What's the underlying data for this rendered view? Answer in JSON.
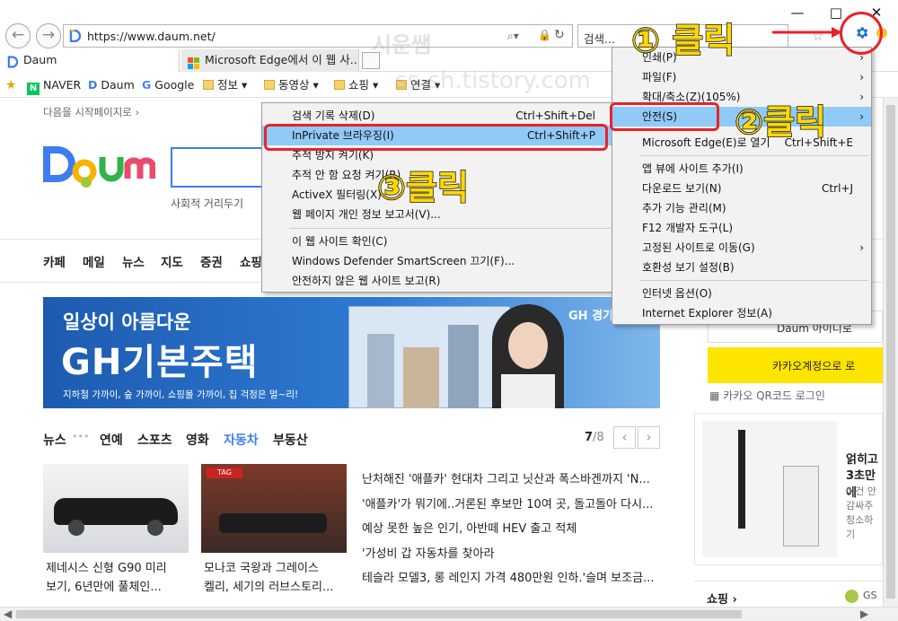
{
  "browser": {
    "url": "https://www.daum.net/",
    "search_placeholder": "검색...",
    "window_min": "—",
    "window_max": "□",
    "window_close": "✕",
    "tabs": [
      "Daum",
      "Microsoft Edge에서 이 웹 사..."
    ],
    "favorites": [
      "NAVER",
      "Daum",
      "Google",
      "정보 ▾",
      "동영상 ▾",
      "쇼핑 ▾",
      "연결 ▾"
    ]
  },
  "watermark": {
    "line1": "시운쌤",
    "line2": "ss-sh.tistory.com"
  },
  "tools_menu": {
    "items": [
      {
        "label": "인쇄(P)",
        "shortcut": "",
        "arrow": "›"
      },
      {
        "label": "파일(F)",
        "shortcut": "",
        "arrow": "›"
      },
      {
        "label": "확대/축소(Z)(105%)",
        "shortcut": "",
        "arrow": "›"
      },
      {
        "label": "안전(S)",
        "shortcut": "",
        "arrow": "›"
      },
      {
        "label": "Microsoft Edge(E)로 열기",
        "shortcut": "Ctrl+Shift+E",
        "arrow": ""
      },
      {
        "label": "앱 뷰에 사이트 추가(I)",
        "shortcut": "",
        "arrow": ""
      },
      {
        "label": "다운로드 보기(N)",
        "shortcut": "Ctrl+J",
        "arrow": ""
      },
      {
        "label": "추가 기능 관리(M)",
        "shortcut": "",
        "arrow": ""
      },
      {
        "label": "F12 개발자 도구(L)",
        "shortcut": "",
        "arrow": ""
      },
      {
        "label": "고정된 사이트로 이동(G)",
        "shortcut": "",
        "arrow": ""
      },
      {
        "label": "호환성 보기 설정(B)",
        "shortcut": "",
        "arrow": ""
      },
      {
        "label": "인터넷 옵션(O)",
        "shortcut": "",
        "arrow": ""
      },
      {
        "label": "Internet Explorer 정보(A)",
        "shortcut": "",
        "arrow": ""
      }
    ]
  },
  "safety_menu": {
    "items": [
      {
        "label": "검색 기록 삭제(D)",
        "shortcut": "Ctrl+Shift+Del"
      },
      {
        "label": "InPrivate 브라우징(I)",
        "shortcut": "Ctrl+Shift+P"
      },
      {
        "label": "추적 방지 켜기(K)",
        "shortcut": ""
      },
      {
        "label": "추적 안 함 요청 켜기(R)",
        "shortcut": ""
      },
      {
        "label": "ActiveX 필터링(X)",
        "shortcut": ""
      },
      {
        "label": "웹 페이지 개인 정보 보고서(V)...",
        "shortcut": ""
      },
      {
        "label": "이 웹 사이트 확인(C)",
        "shortcut": ""
      },
      {
        "label": "Windows Defender SmartScreen 끄기(F)...",
        "shortcut": ""
      },
      {
        "label": "안전하지 않은 웹 사이트 보고(R)",
        "shortcut": ""
      }
    ]
  },
  "annotations": {
    "step1": "① 클릭",
    "step2": "②클릭",
    "step3": "③클릭"
  },
  "daum": {
    "set_start": "다음을 시작페이지로 ›",
    "logo": "Daum",
    "social_distance": "사회적 거리두기",
    "nav": [
      "카페",
      "메일",
      "뉴스",
      "지도",
      "증권",
      "쇼핑"
    ],
    "banner": {
      "line1": "일상이 아름다운",
      "line2": "GH기본주택",
      "line3": "지하철 가까이, 숲 가까이, 쇼핑몰 가까이, 집 걱정은 멀~리!",
      "brand": "GH 경기주"
    },
    "news_tabs": [
      "뉴스",
      "연예",
      "스포츠",
      "영화",
      "자동차",
      "부동산"
    ],
    "dots": "•••",
    "page_current": "7",
    "page_total": "/8",
    "prev": "‹",
    "next": "›",
    "thumbs": [
      {
        "caption1": "제네시스 신형 G90 미리",
        "caption2": "보기, 6년만에 풀체인..."
      },
      {
        "caption1": "모나코 국왕과 그레이스",
        "caption2": "켈리, 세기의 러브스토리..."
      }
    ],
    "headlines": [
      "난처해진 '애플카' 현대차 그리고 닛산과 폭스바겐까지 'N...",
      "'애플카'가 뭐기에..거론된 후보만 10여 곳, 돌고돌아 다시...",
      "예상 못한 높은 인기, 아반떼 HEV 출고 적체",
      "'가성비 갑 자동차를 찾아라",
      "테슬라 모델3, 롱 레인지 가격 480만원 인하.'슬며 보조금..."
    ],
    "right": {
      "daum_id": "Daum 아이디로",
      "kakao": "카카오계정으로 로",
      "qr": "카카오 QR코드 로그인",
      "ad_title": "얽히고",
      "ad_line1": "3초만에",
      "ad_line2": "이건 안",
      "ad_line3": "감싸주",
      "ad_line4": "청소하기",
      "shopping": "쇼핑 ›",
      "gs": "GS"
    }
  },
  "colors": {
    "highlight": "#91c9f7",
    "annotation_red": "#e8232a",
    "annotation_yellow": "#ffd800",
    "banner_blue": "#1f5fb3",
    "kakao_yellow": "#fee500"
  }
}
